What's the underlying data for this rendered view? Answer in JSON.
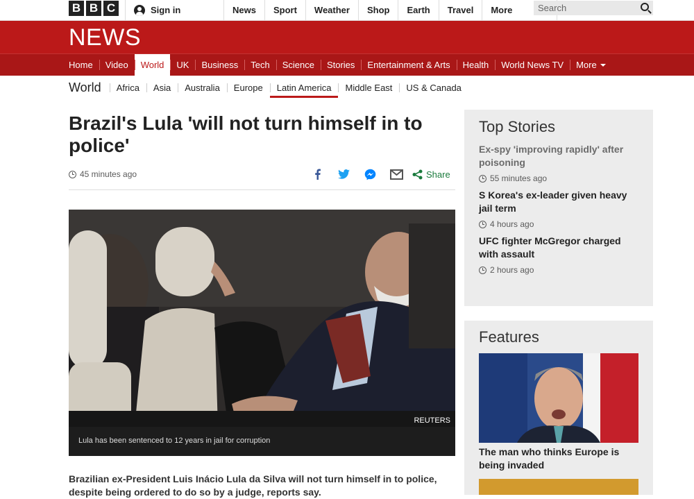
{
  "brand": {
    "letters": [
      "B",
      "B",
      "C"
    ],
    "news_wordmark": "NEWS"
  },
  "topbar": {
    "signin_label": "Sign in",
    "nav": [
      "News",
      "Sport",
      "Weather",
      "Shop",
      "Earth",
      "Travel"
    ],
    "more_label": "More",
    "search_placeholder": "Search"
  },
  "mainnav": {
    "items": [
      {
        "label": "Home"
      },
      {
        "label": "Video"
      },
      {
        "label": "World",
        "active": true
      },
      {
        "label": "UK"
      },
      {
        "label": "Business"
      },
      {
        "label": "Tech"
      },
      {
        "label": "Science"
      },
      {
        "label": "Stories"
      },
      {
        "label": "Entertainment & Arts"
      },
      {
        "label": "Health"
      },
      {
        "label": "World News TV"
      },
      {
        "label": "More"
      }
    ]
  },
  "subnav": {
    "title": "World",
    "items": [
      {
        "label": "Africa"
      },
      {
        "label": "Asia"
      },
      {
        "label": "Australia"
      },
      {
        "label": "Europe"
      },
      {
        "label": "Latin America",
        "active": true
      },
      {
        "label": "Middle East"
      },
      {
        "label": "US & Canada"
      }
    ]
  },
  "article": {
    "headline": "Brazil's Lula 'will not turn himself in to police'",
    "timestamp": "45 minutes ago",
    "share_label": "Share",
    "photo_credit": "REUTERS",
    "caption": "Lula has been sentenced to 12 years in jail for corruption",
    "lead": "Brazilian ex-President Luis Inácio Lula da Silva will not turn himself in to police, despite being ordered to do so by a judge, reports say."
  },
  "top_stories": {
    "title": "Top Stories",
    "items": [
      {
        "title": "Ex-spy 'improving rapidly' after poisoning",
        "time": "55 minutes ago"
      },
      {
        "title": "S Korea's ex-leader given heavy jail term",
        "time": "4 hours ago"
      },
      {
        "title": "UFC fighter McGregor charged with assault",
        "time": "2 hours ago"
      }
    ]
  },
  "features": {
    "title": "Features",
    "items": [
      {
        "title": "The man who thinks Europe is being invaded"
      }
    ]
  },
  "colors": {
    "brand_red": "#bb1919",
    "nav_red": "#a91717",
    "share_green": "#1a7a3c",
    "facebook_blue": "#3b5998",
    "twitter_blue": "#1da1f2",
    "messenger_blue": "#0084ff"
  }
}
